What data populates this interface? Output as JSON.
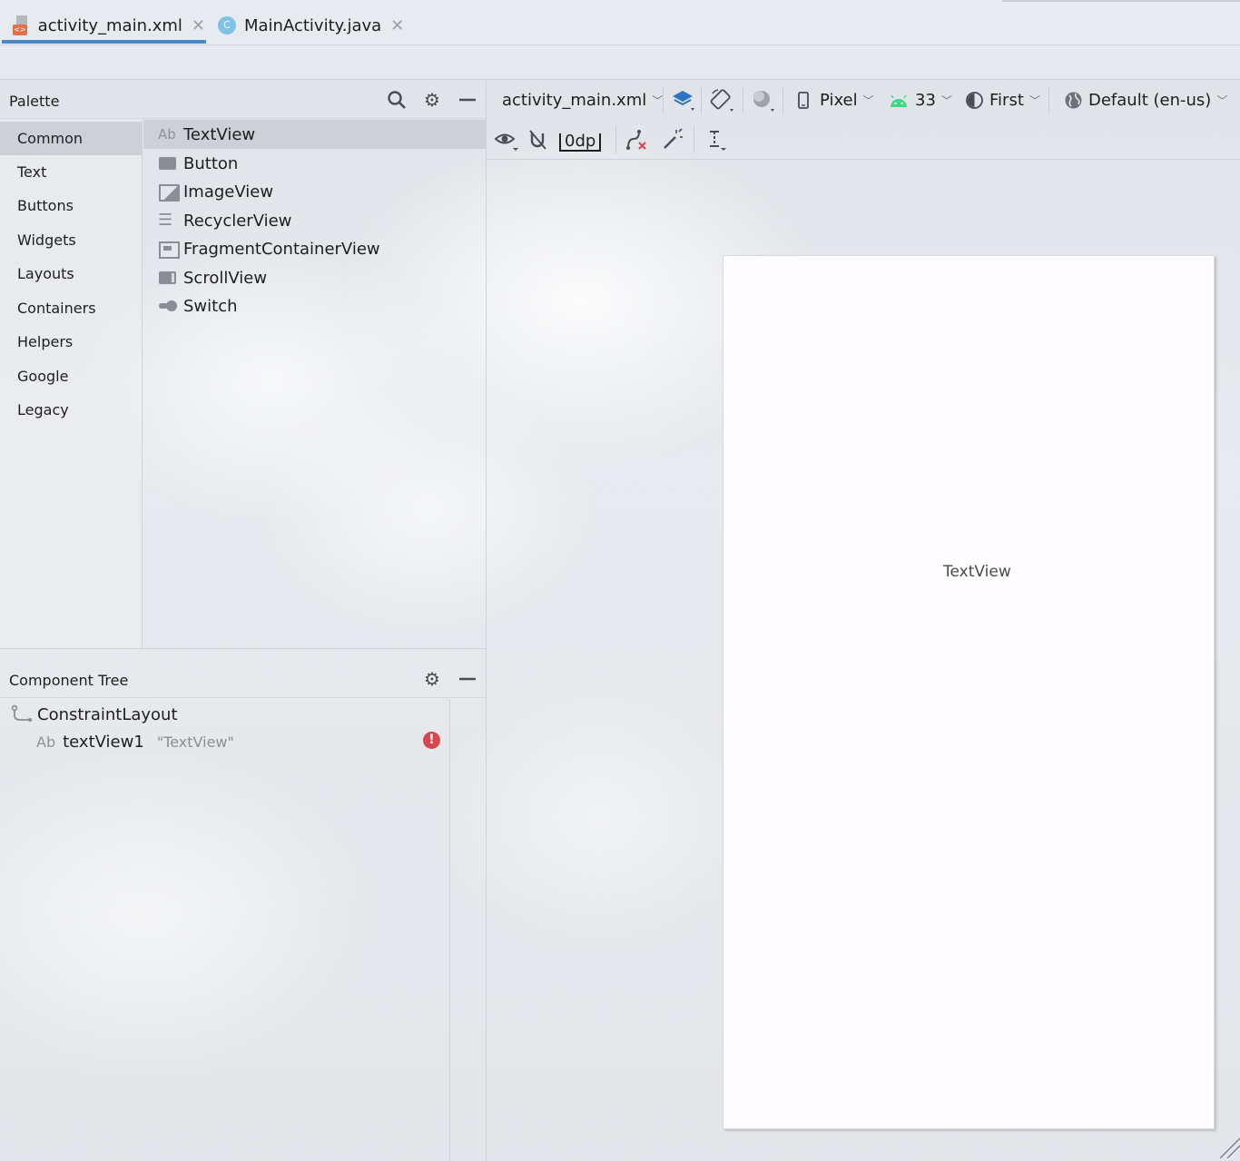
{
  "tabs": [
    {
      "label": "activity_main.xml",
      "active": true,
      "icon": "xml-layout-icon"
    },
    {
      "label": "MainActivity.java",
      "active": false,
      "icon": "java-class-icon",
      "icon_letter": "C"
    }
  ],
  "palette": {
    "title": "Palette",
    "categories": [
      "Common",
      "Text",
      "Buttons",
      "Widgets",
      "Layouts",
      "Containers",
      "Helpers",
      "Google",
      "Legacy"
    ],
    "selected_category": "Common",
    "items": [
      {
        "label": "TextView",
        "icon": "textview-icon",
        "icon_text": "Ab"
      },
      {
        "label": "Button",
        "icon": "button-icon"
      },
      {
        "label": "ImageView",
        "icon": "imageview-icon"
      },
      {
        "label": "RecyclerView",
        "icon": "recyclerview-icon"
      },
      {
        "label": "FragmentContainerView",
        "icon": "fragment-container-icon"
      },
      {
        "label": "ScrollView",
        "icon": "scrollview-icon"
      },
      {
        "label": "Switch",
        "icon": "switch-icon"
      }
    ],
    "selected_item": "TextView"
  },
  "component_tree": {
    "title": "Component Tree",
    "root": "ConstraintLayout",
    "child": {
      "icon_text": "Ab",
      "id": "textView1",
      "hint": "\"TextView\"",
      "status": "error"
    }
  },
  "design_toolbar": {
    "file": "activity_main.xml",
    "device": "Pixel",
    "api": "33",
    "theme": "First",
    "locale": "Default (en-us)",
    "margin": "0dp"
  },
  "preview": {
    "textview_text": "TextView"
  },
  "colors": {
    "accent": "#4a88c7",
    "error": "#d9454d",
    "android_green": "#3ddc84",
    "layers_blue": "#2d74c4"
  }
}
